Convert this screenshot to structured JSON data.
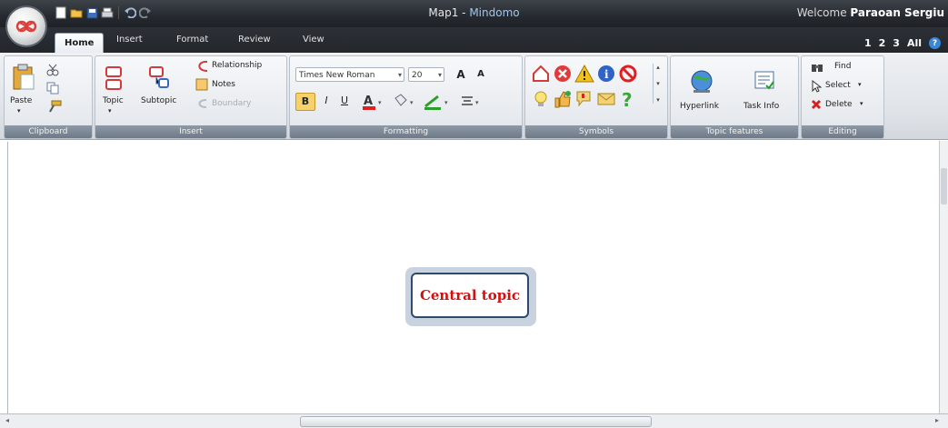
{
  "window": {
    "title_doc": "Map1 - ",
    "title_app": "Mindomo",
    "welcome_text": "Welcome ",
    "user_name": "Paraoan Sergiu"
  },
  "tabs": [
    {
      "label": "Home",
      "active": true
    },
    {
      "label": "Insert",
      "active": false
    },
    {
      "label": "Format",
      "active": false
    },
    {
      "label": "Review",
      "active": false
    },
    {
      "label": "View",
      "active": false
    }
  ],
  "views": {
    "v1": "1",
    "v2": "2",
    "v3": "3",
    "all": "All",
    "help": "?"
  },
  "ribbon": {
    "clipboard": {
      "label": "Clipboard",
      "paste": "Paste"
    },
    "insert": {
      "label": "Insert",
      "topic": "Topic",
      "subtopic": "Subtopic",
      "relationship": "Relationship",
      "notes": "Notes",
      "boundary": "Boundary"
    },
    "formatting": {
      "label": "Formatting",
      "font": "Times New Roman",
      "size": "20",
      "bold": "B",
      "italic": "I",
      "underline": "U",
      "grow": "A",
      "shrink": "A"
    },
    "symbols": {
      "label": "Symbols"
    },
    "topic_features": {
      "label": "Topic features",
      "hyperlink": "Hyperlink",
      "task_info": "Task Info"
    },
    "editing": {
      "label": "Editing",
      "find": "Find",
      "select": "Select",
      "delete": "Delete"
    }
  },
  "map": {
    "central_topic": "Central topic"
  },
  "colors": {
    "accent": "#3a86d8",
    "topic_text": "#d40f0f",
    "topic_border": "#2e4a6d"
  }
}
